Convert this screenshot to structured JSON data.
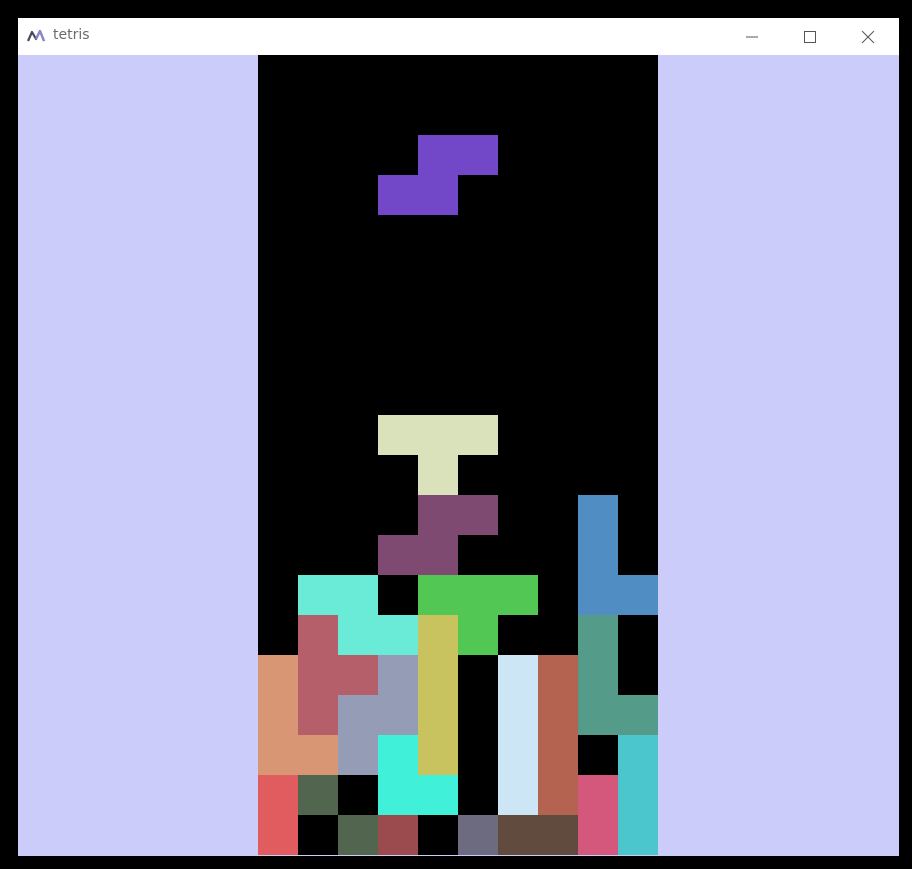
{
  "window": {
    "title": "tetris",
    "background_color": "#ccccfb",
    "icons": {
      "app": "app-logo-icon",
      "minimize": "minimize-icon",
      "maximize": "maximize-icon",
      "close": "close-icon"
    }
  },
  "board": {
    "columns": 10,
    "rows": 20,
    "background_color": "#000000",
    "active_piece": {
      "type": "S",
      "color": "#7348c8",
      "cells": [
        [
          2,
          4
        ],
        [
          2,
          5
        ],
        [
          3,
          3
        ],
        [
          3,
          4
        ]
      ]
    },
    "stack": [
      {
        "row": 9,
        "col": 3,
        "color": "#d9e2bb"
      },
      {
        "row": 9,
        "col": 4,
        "color": "#d9e2bb"
      },
      {
        "row": 9,
        "col": 5,
        "color": "#d9e2bb"
      },
      {
        "row": 10,
        "col": 4,
        "color": "#d9e2bb"
      },
      {
        "row": 11,
        "col": 4,
        "color": "#7f4a72"
      },
      {
        "row": 11,
        "col": 5,
        "color": "#7f4a72"
      },
      {
        "row": 11,
        "col": 8,
        "color": "#508dc3"
      },
      {
        "row": 12,
        "col": 3,
        "color": "#7f4a72"
      },
      {
        "row": 12,
        "col": 4,
        "color": "#7f4a72"
      },
      {
        "row": 12,
        "col": 8,
        "color": "#508dc3"
      },
      {
        "row": 13,
        "col": 1,
        "color": "#69ebd7"
      },
      {
        "row": 13,
        "col": 2,
        "color": "#69ebd7"
      },
      {
        "row": 13,
        "col": 4,
        "color": "#52c753"
      },
      {
        "row": 13,
        "col": 5,
        "color": "#52c753"
      },
      {
        "row": 13,
        "col": 6,
        "color": "#52c753"
      },
      {
        "row": 13,
        "col": 8,
        "color": "#508dc3"
      },
      {
        "row": 13,
        "col": 9,
        "color": "#508dc3"
      },
      {
        "row": 14,
        "col": 1,
        "color": "#b55f6b"
      },
      {
        "row": 14,
        "col": 2,
        "color": "#69ebd7"
      },
      {
        "row": 14,
        "col": 3,
        "color": "#69ebd7"
      },
      {
        "row": 14,
        "col": 4,
        "color": "#c8c35e"
      },
      {
        "row": 14,
        "col": 5,
        "color": "#52c753"
      },
      {
        "row": 14,
        "col": 8,
        "color": "#549b89"
      },
      {
        "row": 15,
        "col": 0,
        "color": "#d99674"
      },
      {
        "row": 15,
        "col": 1,
        "color": "#b55f6b"
      },
      {
        "row": 15,
        "col": 2,
        "color": "#b55f6b"
      },
      {
        "row": 15,
        "col": 3,
        "color": "#949db5"
      },
      {
        "row": 15,
        "col": 4,
        "color": "#c8c35e"
      },
      {
        "row": 15,
        "col": 6,
        "color": "#cde6f5"
      },
      {
        "row": 15,
        "col": 7,
        "color": "#b3634f"
      },
      {
        "row": 15,
        "col": 8,
        "color": "#549b89"
      },
      {
        "row": 16,
        "col": 0,
        "color": "#d99674"
      },
      {
        "row": 16,
        "col": 1,
        "color": "#b55f6b"
      },
      {
        "row": 16,
        "col": 2,
        "color": "#949db5"
      },
      {
        "row": 16,
        "col": 3,
        "color": "#949db5"
      },
      {
        "row": 16,
        "col": 4,
        "color": "#c8c35e"
      },
      {
        "row": 16,
        "col": 6,
        "color": "#cde6f5"
      },
      {
        "row": 16,
        "col": 7,
        "color": "#b3634f"
      },
      {
        "row": 16,
        "col": 8,
        "color": "#549b89"
      },
      {
        "row": 16,
        "col": 9,
        "color": "#549b89"
      },
      {
        "row": 17,
        "col": 0,
        "color": "#d99674"
      },
      {
        "row": 17,
        "col": 1,
        "color": "#d99674"
      },
      {
        "row": 17,
        "col": 2,
        "color": "#949db5"
      },
      {
        "row": 17,
        "col": 3,
        "color": "#41f0d9"
      },
      {
        "row": 17,
        "col": 4,
        "color": "#c8c35e"
      },
      {
        "row": 17,
        "col": 6,
        "color": "#cde6f5"
      },
      {
        "row": 17,
        "col": 7,
        "color": "#b3634f"
      },
      {
        "row": 17,
        "col": 9,
        "color": "#4bc6cd"
      },
      {
        "row": 18,
        "col": 0,
        "color": "#e15c5e"
      },
      {
        "row": 18,
        "col": 1,
        "color": "#52654f"
      },
      {
        "row": 18,
        "col": 3,
        "color": "#41f0d9"
      },
      {
        "row": 18,
        "col": 4,
        "color": "#41f0d9"
      },
      {
        "row": 18,
        "col": 6,
        "color": "#cde6f5"
      },
      {
        "row": 18,
        "col": 7,
        "color": "#b3634f"
      },
      {
        "row": 18,
        "col": 8,
        "color": "#d4577c"
      },
      {
        "row": 18,
        "col": 9,
        "color": "#4bc6cd"
      },
      {
        "row": 19,
        "col": 0,
        "color": "#e15c5e"
      },
      {
        "row": 19,
        "col": 2,
        "color": "#52654f"
      },
      {
        "row": 19,
        "col": 3,
        "color": "#9b4a4e"
      },
      {
        "row": 19,
        "col": 5,
        "color": "#6d6b80"
      },
      {
        "row": 19,
        "col": 6,
        "color": "#614a3e"
      },
      {
        "row": 19,
        "col": 7,
        "color": "#614a3e"
      },
      {
        "row": 19,
        "col": 8,
        "color": "#d4577c"
      },
      {
        "row": 19,
        "col": 9,
        "color": "#4bc6cd"
      }
    ]
  }
}
